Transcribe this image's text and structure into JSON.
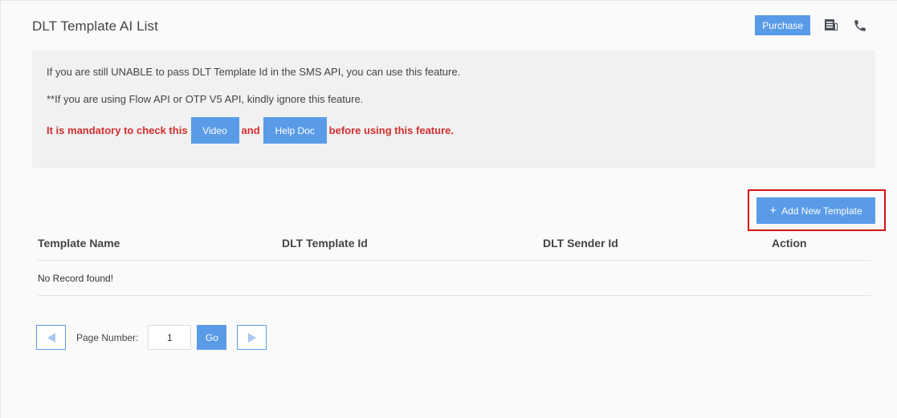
{
  "page": {
    "title": "DLT Template AI List"
  },
  "header": {
    "purchase_label": "Purchase",
    "icons": [
      "receipt-icon",
      "phone-icon"
    ]
  },
  "info": {
    "line1": "If you are still UNABLE to pass DLT Template Id in the SMS API, you can use this feature.",
    "line2": "**If you are using Flow API or OTP V5 API, kindly ignore this feature.",
    "mandatory_prefix": "It is mandatory to check this",
    "video_label": "Video",
    "and_text": "and",
    "helpdoc_label": "Help Doc",
    "mandatory_suffix": "before using this feature."
  },
  "actions": {
    "add_plus": "+",
    "add_label": "Add New Template"
  },
  "table": {
    "columns": [
      "Template Name",
      "DLT Template Id",
      "DLT Sender Id",
      "Action"
    ],
    "empty_message": "No Record found!"
  },
  "pagination": {
    "label": "Page Number:",
    "value": "1",
    "go_label": "Go"
  },
  "colors": {
    "accent": "#5a9be8",
    "warning_text": "#d12f2f",
    "highlight_border": "#d61414"
  }
}
